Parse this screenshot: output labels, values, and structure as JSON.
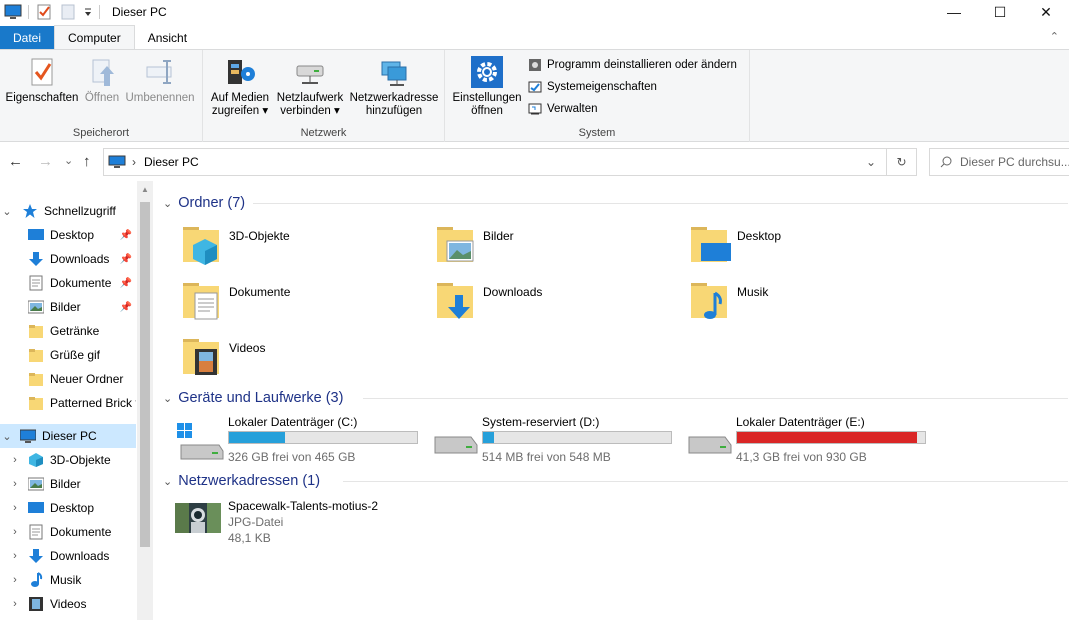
{
  "window": {
    "title": "Dieser PC",
    "minimize": "—",
    "maximize": "☐",
    "close": "✕"
  },
  "ribbon": {
    "tabs": [
      {
        "label": "Datei"
      },
      {
        "label": "Computer"
      },
      {
        "label": "Ansicht"
      }
    ],
    "collapse": "⌃",
    "groups": {
      "speicherort": {
        "label": "Speicherort",
        "buttons": [
          {
            "label": "Eigenschaften",
            "icon": "properties-icon"
          },
          {
            "label": "Öffnen",
            "icon": "open-icon"
          },
          {
            "label": "Umbenennen",
            "icon": "rename-icon"
          }
        ]
      },
      "netzwerk": {
        "label": "Netzwerk",
        "buttons": [
          {
            "line1": "Auf Medien",
            "line2": "zugreifen ▾",
            "icon": "media-access-icon"
          },
          {
            "line1": "Netzlaufwerk",
            "line2": "verbinden ▾",
            "icon": "map-drive-icon"
          },
          {
            "line1": "Netzwerkadresse",
            "line2": "hinzufügen",
            "icon": "add-network-location-icon"
          }
        ]
      },
      "system": {
        "label": "System",
        "settings_line1": "Einstellungen",
        "settings_line2": "öffnen",
        "items": [
          {
            "label": "Programm deinstallieren oder ändern",
            "icon": "uninstall-icon"
          },
          {
            "label": "Systemeigenschaften",
            "icon": "system-properties-icon"
          },
          {
            "label": "Verwalten",
            "icon": "manage-icon"
          }
        ]
      }
    }
  },
  "address": {
    "back": "←",
    "forward": "→",
    "history": "⌄",
    "up": "↑",
    "crumb_sep": "›",
    "path": "Dieser PC",
    "dropdown": "⌄",
    "refresh": "↻",
    "search_placeholder": "Dieser PC durchsu..."
  },
  "nav": {
    "quick_access": "Schnellzugriff",
    "quick_items": [
      {
        "label": "Desktop",
        "pinned": true
      },
      {
        "label": "Downloads",
        "pinned": true
      },
      {
        "label": "Dokumente",
        "pinned": true
      },
      {
        "label": "Bilder",
        "pinned": true
      },
      {
        "label": "Getränke"
      },
      {
        "label": "Grüße gif"
      },
      {
        "label": "Neuer Ordner"
      },
      {
        "label": "Patterned Brick f"
      }
    ],
    "this_pc": "Dieser PC",
    "pc_items": [
      {
        "label": "3D-Objekte"
      },
      {
        "label": "Bilder"
      },
      {
        "label": "Desktop"
      },
      {
        "label": "Dokumente"
      },
      {
        "label": "Downloads"
      },
      {
        "label": "Musik"
      },
      {
        "label": "Videos"
      }
    ]
  },
  "content": {
    "folders_header": "Ordner (7)",
    "folders": [
      {
        "label": "3D-Objekte",
        "icon": "3d-objects-folder-icon"
      },
      {
        "label": "Bilder",
        "icon": "pictures-folder-icon"
      },
      {
        "label": "Desktop",
        "icon": "desktop-folder-icon"
      },
      {
        "label": "Dokumente",
        "icon": "documents-folder-icon"
      },
      {
        "label": "Downloads",
        "icon": "downloads-folder-icon"
      },
      {
        "label": "Musik",
        "icon": "music-folder-icon"
      },
      {
        "label": "Videos",
        "icon": "videos-folder-icon"
      }
    ],
    "drives_header": "Geräte und Laufwerke (3)",
    "drives": [
      {
        "label": "Lokaler Datenträger (C:)",
        "free": "326 GB frei von 465 GB",
        "used_fraction": 0.3,
        "color": "#26a0da"
      },
      {
        "label": "System-reserviert (D:)",
        "free": "514 MB frei von 548 MB",
        "used_fraction": 0.06,
        "color": "#26a0da"
      },
      {
        "label": "Lokaler Datenträger (E:)",
        "free": "41,3 GB frei von 930 GB",
        "used_fraction": 0.96,
        "color": "#da2626"
      }
    ],
    "network_header": "Netzwerkadressen (1)",
    "network": {
      "name": "Spacewalk-Talents-motius-2",
      "type": "JPG-Datei",
      "size": "48,1 KB"
    }
  }
}
